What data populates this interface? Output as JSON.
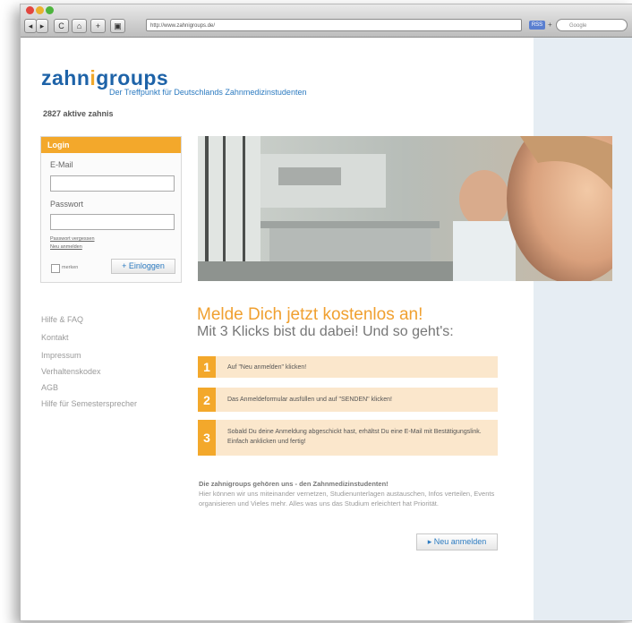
{
  "browser": {
    "nav_back": "◂",
    "nav_forward": "▸",
    "reload": "C",
    "home": "⌂",
    "add": "+",
    "url": "http://www.zahnigroups.de/",
    "rss": "RSS",
    "plus": "+",
    "search_placeholder": "Google"
  },
  "header": {
    "logo_pre": "zahn",
    "logo_mark": "i",
    "logo_post": "groups",
    "tagline": "Der Treffpunkt für Deutschlands Zahnmedizinstudenten",
    "active_count": "2827 aktive zahnis"
  },
  "login": {
    "title": "Login",
    "email_label": "E-Mail",
    "password_label": "Passwort",
    "forgot_link": "Passwort vergessen",
    "register_link": "Neu anmelden",
    "remember_label": "merken",
    "submit_label": "+ Einloggen"
  },
  "sidebar": {
    "items": [
      {
        "label": "Hilfe & FAQ"
      },
      {
        "label": "Kontakt"
      },
      {
        "label": "Impressum"
      },
      {
        "label": "Verhaltenskodex"
      },
      {
        "label": "AGB"
      },
      {
        "label": "Hilfe für Semestersprecher"
      }
    ]
  },
  "main": {
    "headline": "Melde Dich jetzt kostenlos an!",
    "subheadline": "Mit 3 Klicks bist du dabei! Und so geht's:",
    "steps": [
      {
        "num": "1",
        "text": "Auf \"Neu anmelden\" klicken!"
      },
      {
        "num": "2",
        "text": "Das Anmeldeformular ausfüllen und auf \"SENDEN\" klicken!"
      },
      {
        "num": "3",
        "text": "Sobald Du deine Anmeldung abgeschickt hast, erhältst Du eine E-Mail mit Bestätigungslink. Einfach anklicken und fertig!"
      }
    ],
    "about_title": "Die zahnigroups gehören uns - den Zahnmedizinstudenten!",
    "about_text": "Hier können wir uns miteinander vernetzen, Studienunterlagen austauschen, Infos verteilen, Events organisieren und Vieles mehr. Alles was uns das Studium erleichtert hat Priorität.",
    "register_button": "▸ Neu anmelden"
  },
  "colors": {
    "accent_orange": "#f3a82b",
    "brand_blue": "#1e63a8",
    "step_bg": "#fbe7cc",
    "right_panel": "#e6edf3"
  }
}
